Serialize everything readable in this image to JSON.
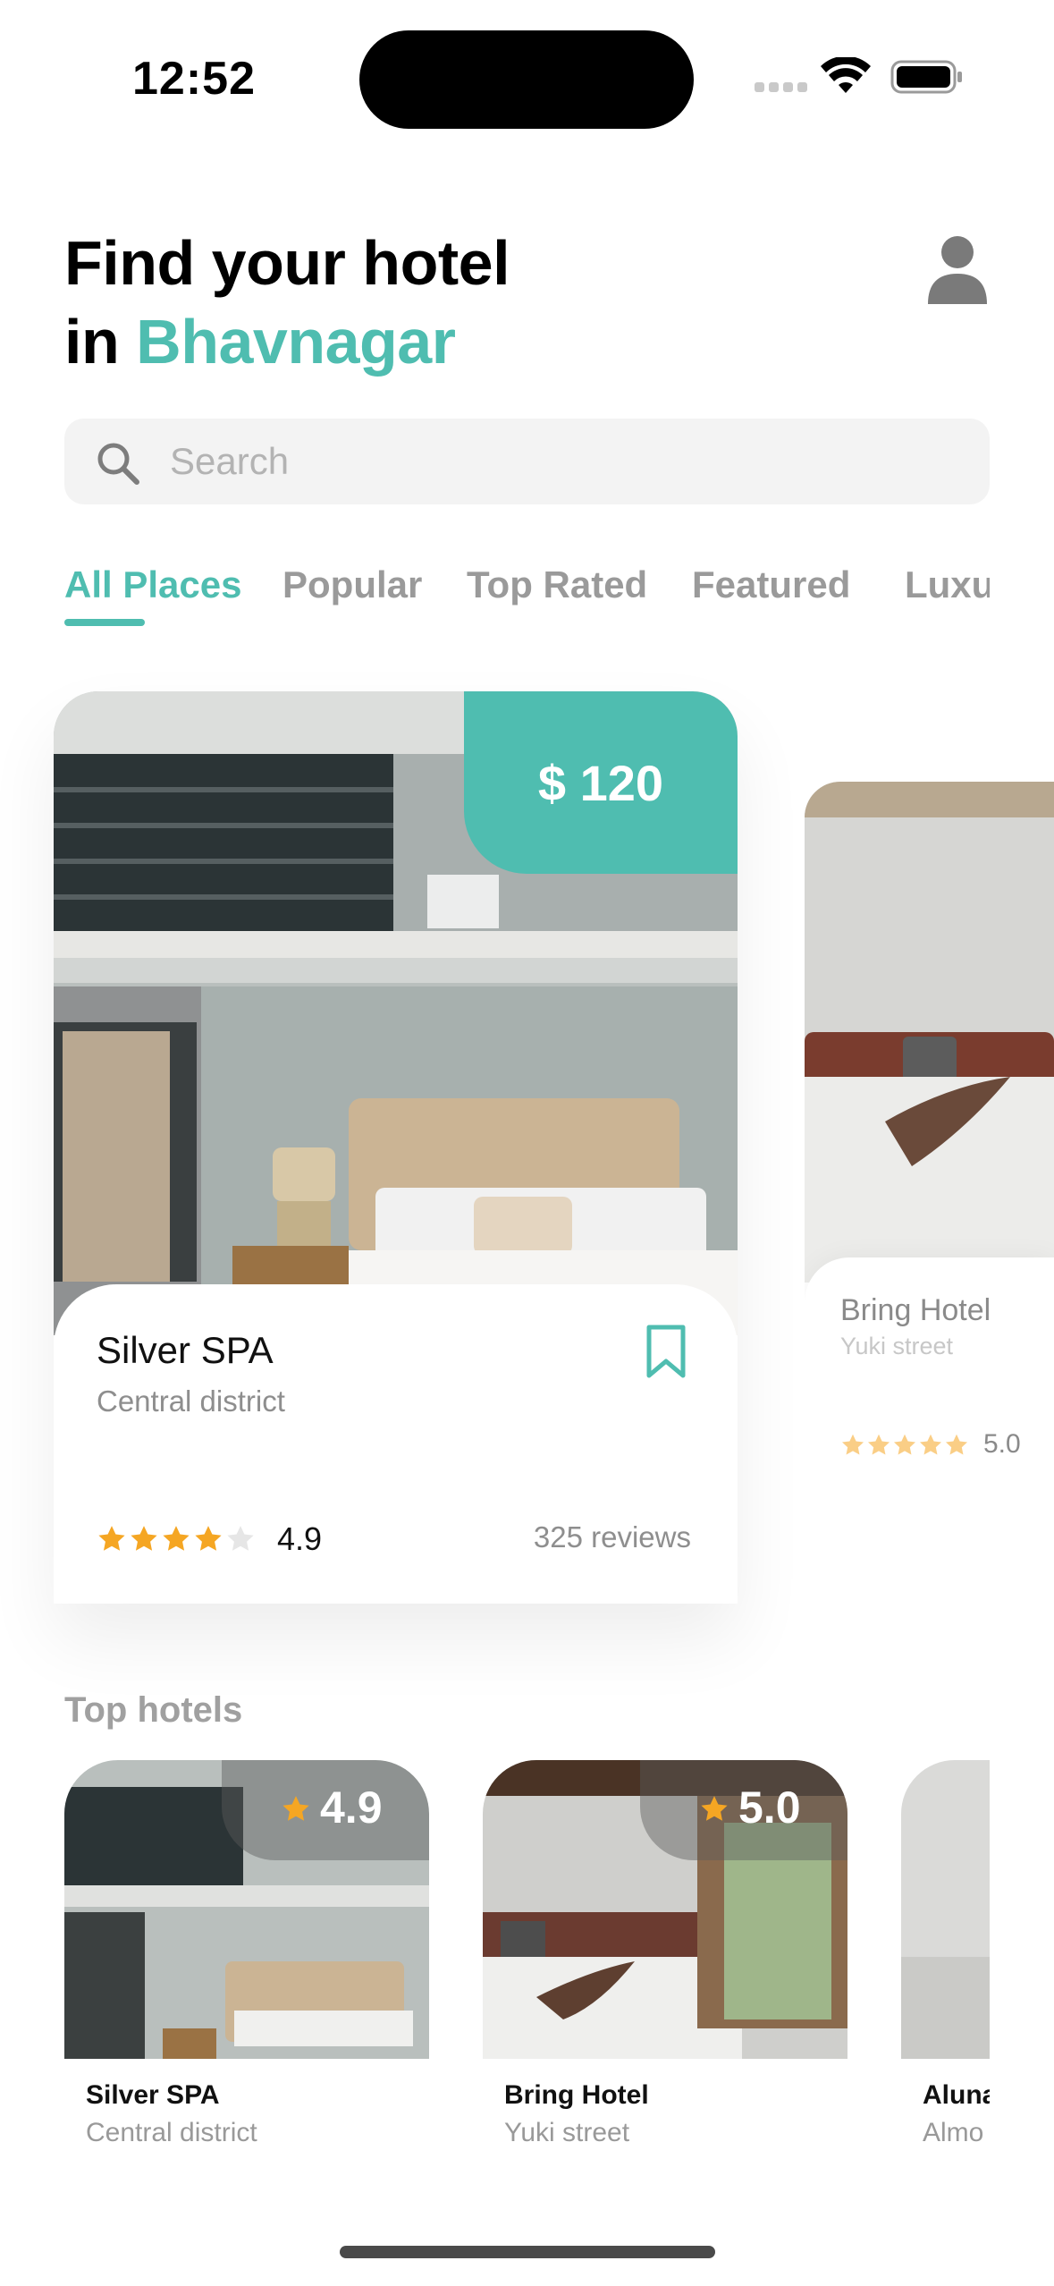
{
  "status_bar": {
    "time": "12:52"
  },
  "header": {
    "title_line1": "Find your hotel",
    "title_prefix": "in ",
    "city": "Bhavnagar"
  },
  "search": {
    "placeholder": "Search"
  },
  "tabs": [
    {
      "label": "All Places",
      "active": true
    },
    {
      "label": "Popular",
      "active": false
    },
    {
      "label": "Top Rated",
      "active": false
    },
    {
      "label": "Featured",
      "active": false
    },
    {
      "label": "Luxury",
      "active": false
    }
  ],
  "featured": [
    {
      "name": "Silver SPA",
      "location": "Central district",
      "price": "$ 120",
      "rating": "4.9",
      "stars": 4,
      "reviews": "325 reviews"
    },
    {
      "name": "Bring Hotel",
      "location": "Yuki street",
      "rating": "5.0",
      "stars": 5
    }
  ],
  "top_hotels": {
    "title": "Top hotels",
    "items": [
      {
        "name": "Silver SPA",
        "location": "Central district",
        "rating": "4.9"
      },
      {
        "name": "Bring Hotel",
        "location": "Yuki street",
        "rating": "5.0"
      },
      {
        "name": "Aluna",
        "location": "Almo"
      }
    ]
  },
  "colors": {
    "accent": "#4fbdb0",
    "star": "#f5a623",
    "star_empty": "#e6e6e6"
  },
  "icons": [
    "search-icon",
    "person-icon",
    "bookmark-icon",
    "star-icon",
    "wifi-icon",
    "battery-icon"
  ]
}
